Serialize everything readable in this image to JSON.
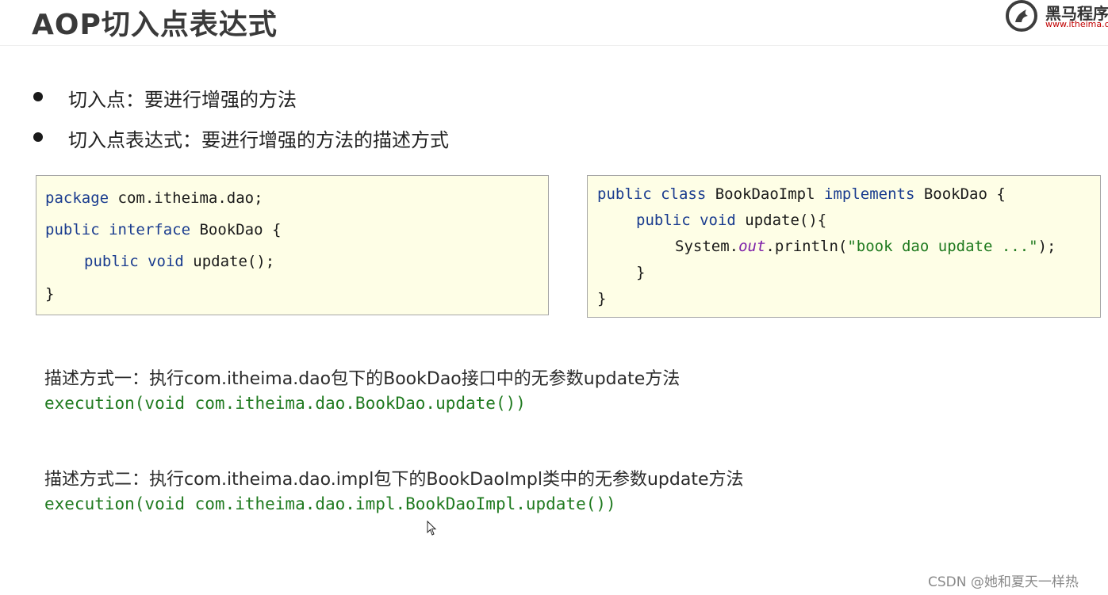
{
  "header": {
    "title": "AOP切入点表达式",
    "logo_name": "黑马程序",
    "logo_url": "www.itheima.c"
  },
  "bullets": [
    {
      "text": "切入点：要进行增强的方法"
    },
    {
      "text": "切入点表达式：要进行增强的方法的描述方式"
    }
  ],
  "code_left": {
    "line1_kw": "package",
    "line1_rest": " com.itheima.dao;",
    "line2_kw": "public interface",
    "line2_rest": " BookDao {",
    "line3_kw": "public void",
    "line3_rest": " update();",
    "line4": "}"
  },
  "code_right": {
    "line1_kw1": "public class",
    "line1_mid": " BookDaoImpl ",
    "line1_kw2": "implements",
    "line1_rest": " BookDao {",
    "line2_kw": "public void",
    "line2_rest": " update(){",
    "line3_a": "System.",
    "line3_italic": "out",
    "line3_b": ".println(",
    "line3_str": "\"book dao update ...\"",
    "line3_c": ");",
    "line4": "}",
    "line5": "}"
  },
  "descriptions": [
    {
      "text": "描述方式一：执行com.itheima.dao包下的BookDao接口中的无参数update方法",
      "expression": "execution(void com.itheima.dao.BookDao.update())"
    },
    {
      "text": "描述方式二：执行com.itheima.dao.impl包下的BookDaoImpl类中的无参数update方法",
      "expression": "execution(void com.itheima.dao.impl.BookDaoImpl.update())"
    }
  ],
  "watermark": "CSDN @她和夏天一样热",
  "colors": {
    "keyword": "#1a3c8f",
    "string": "#1f7a1f",
    "code_background": "#fefee6",
    "logo_url": "#c00000"
  }
}
